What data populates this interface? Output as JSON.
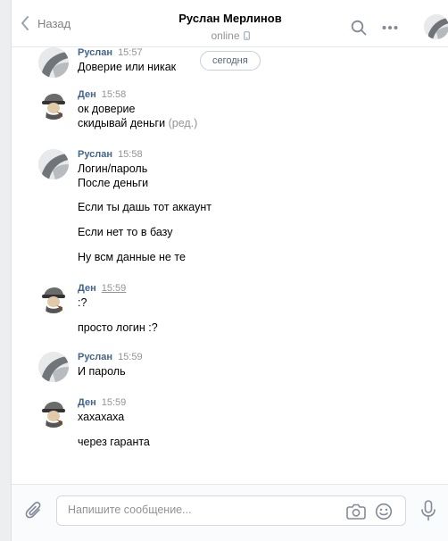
{
  "header": {
    "back_label": "Назад",
    "title": "Руслан Мерлинов",
    "status": "online"
  },
  "date_pill": "сегодня",
  "messages": [
    {
      "author": "Руслан",
      "time": "15:57",
      "lines": [
        "Доверие или никак"
      ]
    },
    {
      "author": "Ден",
      "time": "15:58",
      "lines": [
        "ок доверие",
        "скидывай деньги"
      ],
      "edited": "(ред.)"
    },
    {
      "author": "Руслан",
      "time": "15:58",
      "lines": [
        "Логин/пароль",
        "После деньги",
        "Если ты дашь тот аккаунт",
        "Если нет то в базу",
        "Ну всм данные не те"
      ]
    },
    {
      "author": "Ден",
      "time": "15:59",
      "lines": [
        ":?",
        "просто логин :?"
      ]
    },
    {
      "author": "Руслан",
      "time": "15:59",
      "lines": [
        "И пароль"
      ]
    },
    {
      "author": "Ден",
      "time": "15:59",
      "lines": [
        "хахахаха",
        "через гаранта"
      ]
    }
  ],
  "composer": {
    "placeholder": "Напишите сообщение..."
  },
  "icons": {
    "back": "chevron-left-icon",
    "phone": "mobile-phone-icon",
    "search": "search-icon",
    "more": "more-horizontal-icon",
    "attach": "paperclip-icon",
    "camera": "camera-icon",
    "emoji": "smile-icon",
    "voice": "microphone-icon"
  },
  "colors": {
    "author": "#42648b",
    "muted": "#939393",
    "background": "#edeef0",
    "pill_border": "#c5d0db"
  }
}
